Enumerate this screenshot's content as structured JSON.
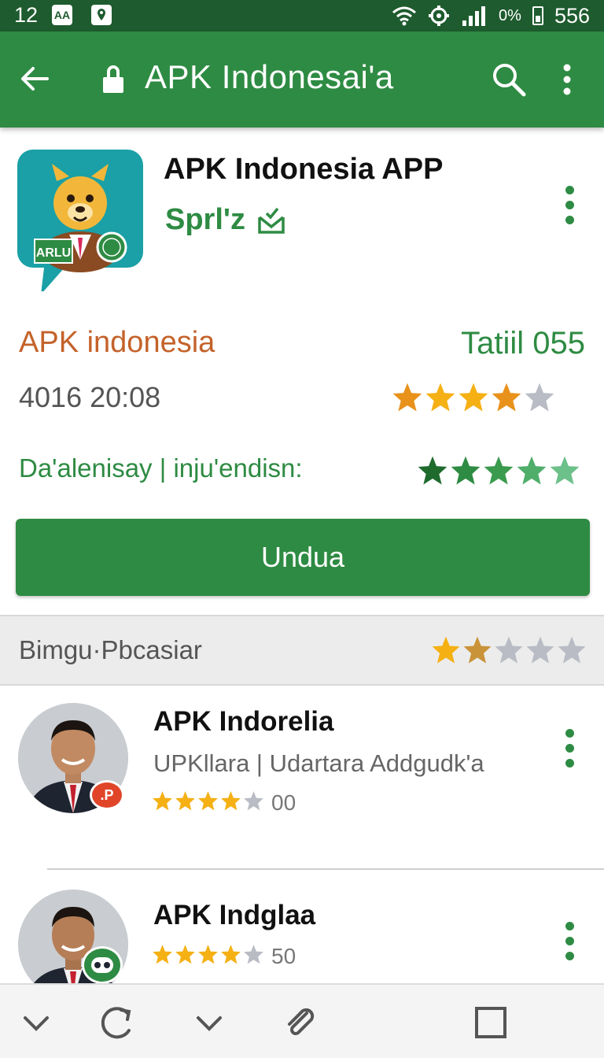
{
  "status_bar": {
    "time": "12",
    "box1_label": "AA",
    "battery_percent": "0%",
    "right_value": "556"
  },
  "app_bar": {
    "title": "APK Indonesai'a",
    "color": "#2e8b43"
  },
  "app": {
    "name": "APK Indonesia APP",
    "developer": "Sprl'z",
    "icon_badge_text": "ARLU",
    "publisher": "APK indonesia",
    "size_label": "Tatiil 055",
    "date": "4016 20:08",
    "rating_1": 4,
    "category_line": "Da'alenisay | inju'endisn:",
    "rating_2": 5,
    "install_label": "Undua"
  },
  "section": {
    "title": "Bimgu·Pbcasiar",
    "rating": 2
  },
  "list": [
    {
      "title": "APK Indorelia",
      "subtitle": "UPKllara | Udartara Addgudk'a",
      "rating": 4,
      "count": "00",
      "badge_text": ".P"
    },
    {
      "title": "APK Indglaa",
      "rating": 4,
      "count": "50"
    }
  ],
  "icons": {
    "status": [
      "wifi-icon",
      "sync-icon",
      "signal-icon",
      "battery-icon"
    ],
    "app_bar": [
      "back-arrow-icon",
      "lock-icon",
      "search-icon",
      "more-vert-icon"
    ],
    "bottom_nav": [
      "chevron-down-icon",
      "refresh-icon",
      "chevron-down-icon",
      "attachment-icon",
      "square-icon"
    ]
  },
  "colors": {
    "primary": "#2e8b43",
    "dark_primary": "#1e5b2e",
    "publisher_orange": "#c4622a",
    "star_gold": "#f5b014",
    "star_gray": "#b9bcc4"
  }
}
